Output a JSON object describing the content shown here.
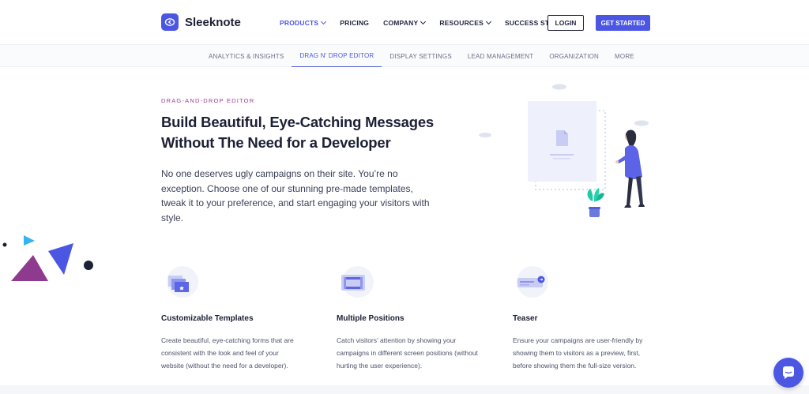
{
  "brand": {
    "name": "Sleeknote",
    "color": "#4b57e3"
  },
  "nav": {
    "items": [
      {
        "label": "PRODUCTS",
        "dropdown": true,
        "active": true
      },
      {
        "label": "PRICING",
        "dropdown": false
      },
      {
        "label": "COMPANY",
        "dropdown": true
      },
      {
        "label": "RESOURCES",
        "dropdown": true
      },
      {
        "label": "SUCCESS STORIES",
        "dropdown": false
      }
    ],
    "login_label": "LOGIN",
    "cta_label": "GET STARTED"
  },
  "subnav": {
    "tabs": [
      {
        "label": "ANALYTICS & INSIGHTS",
        "active": false
      },
      {
        "label": "DRAG N' DROP EDITOR",
        "active": true
      },
      {
        "label": "DISPLAY SETTINGS",
        "active": false
      },
      {
        "label": "LEAD MANAGEMENT",
        "active": false
      },
      {
        "label": "ORGANIZATION",
        "active": false
      },
      {
        "label": "MORE",
        "active": false
      }
    ]
  },
  "hero": {
    "eyebrow": "DRAG-AND-DROP EDITOR",
    "title_line1": "Build Beautiful, Eye-Catching Messages",
    "title_line2": "Without The Need for a Developer",
    "description": "No one deserves ugly campaigns on their site. You’re no exception. Choose one of our stunning pre-made templates, tweak it to your preference, and start engaging your visitors with style."
  },
  "features": [
    {
      "icon": "templates-icon",
      "title": "Customizable Templates",
      "description": "Create beautiful, eye-catching forms that are consistent with the look and feel of your website (without the need for a developer)."
    },
    {
      "icon": "positions-icon",
      "title": "Multiple Positions",
      "description": "Catch visitors’ attention by showing your campaigns in different screen positions (without hurting the user experience)."
    },
    {
      "icon": "teaser-icon",
      "title": "Teaser",
      "description": "Ensure your campaigns are user-friendly by showing them to visitors as a preview, first, before showing them the full-size version."
    }
  ],
  "chat": {
    "icon": "chat-bubble-icon"
  }
}
